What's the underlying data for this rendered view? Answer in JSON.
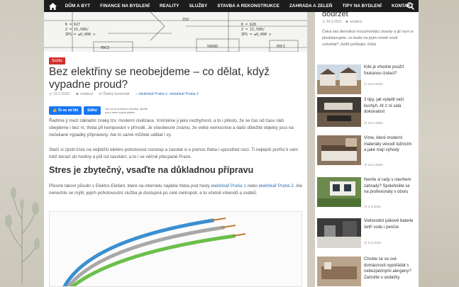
{
  "nav": {
    "items": [
      "DŮM A BYT",
      "FINANCE NA BYDLENÍ",
      "REALITY",
      "SLUŽBY",
      "STAVBA A REKONSTRUKCE",
      "ZAHRADA A ZELEŇ",
      "TIPY NA BYDLENÍ",
      "KONTAKT"
    ]
  },
  "hero": {
    "blueprint_labels": [
      "K = 627",
      "Z = 15,500/",
      "ZPS = ±0,000 v",
      "K = 626",
      "Z = 15,500/",
      "ZPS = ±0,000 v",
      "ZSV",
      "PDCI",
      "PDCI",
      "500XD"
    ]
  },
  "article": {
    "category": "Služby",
    "title": "Bez elektřiny se neobejdeme – co dělat, když vypadne proud?",
    "date": "19.2.2020",
    "author": "redakce",
    "comments": "Šádný komentář",
    "tags": "elektrikář Praha 1, elektrikář Praha 2",
    "fb_like": "To se mi líbí",
    "fb_share": "Sdílet",
    "fb_note": "Líbí se to jednomu člověku. Buďte první mezi svými přáteli.",
    "para1": "Řadíme ji mezi základní znaky tzv. moderní civilizace. Vnímáme ji jako nezbytnost, a to i přesto, že se čas od času rádi obejdeme i bez ní, třeba při kempování v přírodě. Je všeobecně známo, že velké nemocnice a další důležité objekty jsou na nečekané výpadky připraveny. Ale to samé můžete udělat i vy.",
    "para2": "Stačí si zjistit číslo na nejbližší elektro pohotovost nonstop a zavolat si o pomoc třeba i uprostřed noci. Ti nejlepší profíci k vám totiž dorazí do hodiny a půl od zavolání, a to i ve věčně přecpané Praze.",
    "h2": "Stres je zbytečný, vsaďte na důkladnou přípravu",
    "para3_a": "Přesně takoví působí v Elektro-Elefant, které na internetu najdete třeba pod hesly ",
    "para3_link1": "elektrikář Praha 1",
    "para3_b": " nebo ",
    "para3_link2": "elektrikář Praha 2",
    "para3_c": ". Ale nenechte se mýlit, jejich pohotovostní služba je dostupná po celé metropoli, a to včetně víkendů a svátků."
  },
  "sidebar": {
    "top_title": "dodržet",
    "top_date": "24.3.2021",
    "top_author": "redakce",
    "top_text": "Čeká vás demolice trouchnivějící stavby a již nyní si představujete, co bude na jejím místě nově vzkvétat? Ještě počkejte, čeká",
    "posts": [
      {
        "title": "Kde je vhodné použít foukanou izolaci?",
        "date": "24.3.2021"
      },
      {
        "title": "3 tipy, jak vyladit vaši kuchyň. Ať z ní sálá dokonalost",
        "date": "24.3.2021"
      },
      {
        "title": "Víme, které moderní materiály vévodí ložnicím a jaké mají výhody",
        "date": "18.3.2021"
      },
      {
        "title": "Nevíte si rady s návrhem zahrady? Spolehněte se na profesionály v oboru",
        "date": "4.3.2021"
      },
      {
        "title": "Vodovodní pákové baterie šetří vodu i peníze",
        "date": "2.3.2021"
      },
      {
        "title": "Chcete se ve své domácnosti vypořádat s nebezpečnými alergeny? Začněte u sedačky",
        "date": ""
      }
    ]
  },
  "colors": {
    "nav_bg": "#1c1c1c",
    "badge": "#d32f2f",
    "link": "#2f6fb3",
    "fb": "#1877f2"
  }
}
